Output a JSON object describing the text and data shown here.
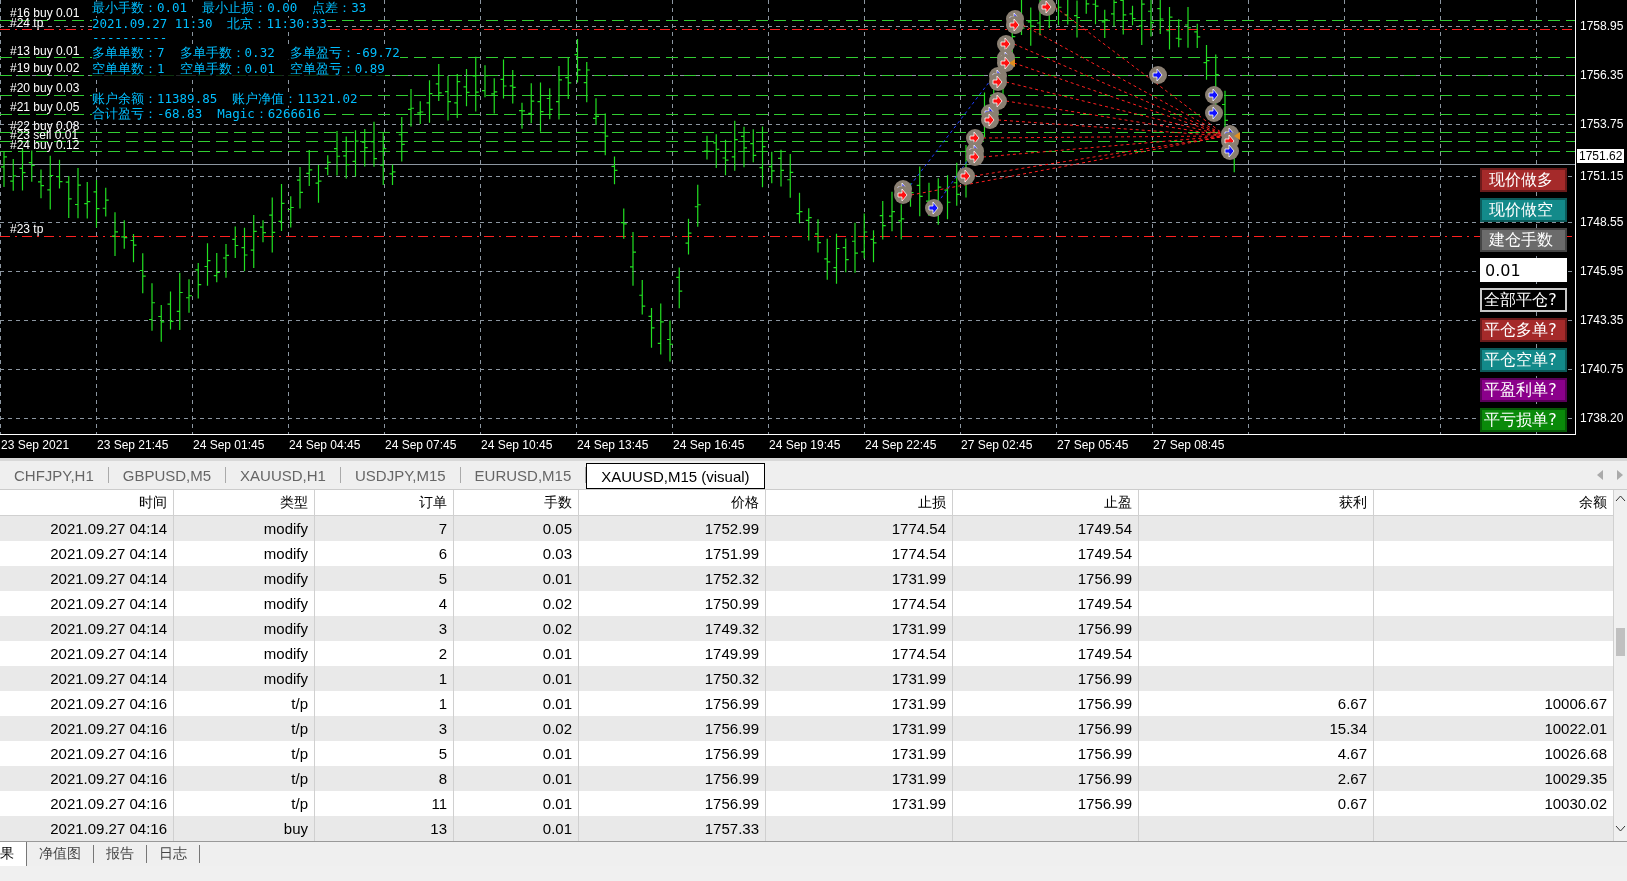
{
  "chart": {
    "info_lines": [
      "最小手数：0.01  最小止损：0.00  点差：33",
      "2021.09.27 11:30  北京：11:30:33",
      "----------",
      "多单单数：7  多单手数：0.32  多单盈亏：-69.72",
      "空单单数：1  空单手数：0.01  空单盈亏：0.89",
      "账户余额：11389.85  账户净值：11321.02",
      "合计盈亏：-68.83  Magic：6266616"
    ],
    "order_labels": [
      "#16 buy 0.01",
      "#24 tp",
      "#13 buy 0.01",
      "#19 buy 0.02",
      "#20 buy 0.03",
      "#21 buy 0.05",
      "#22 buy 0.08",
      "#23 sell 0.01",
      "#24 buy 0.12",
      "#23 tp"
    ],
    "price_labels": [
      "1758.95",
      "1756.35",
      "1753.75",
      "1751.15",
      "1748.55",
      "1745.95",
      "1743.35",
      "1740.75",
      "1738.20"
    ],
    "current_price": "1751.62",
    "time_labels": [
      "23 Sep 2021",
      "23 Sep 21:45",
      "24 Sep 01:45",
      "24 Sep 04:45",
      "24 Sep 07:45",
      "24 Sep 10:45",
      "24 Sep 13:45",
      "24 Sep 16:45",
      "24 Sep 19:45",
      "24 Sep 22:45",
      "27 Sep 02:45",
      "27 Sep 05:45",
      "27 Sep 08:45"
    ],
    "controls": [
      {
        "kind": "button",
        "label": "现价做多",
        "color": "#a52a2a"
      },
      {
        "kind": "button",
        "label": "现价做空",
        "color": "#138a8a"
      },
      {
        "kind": "button",
        "label": "建仓手数",
        "color": "#6b6b6b"
      },
      {
        "kind": "input",
        "value": "0.01"
      },
      {
        "kind": "outline",
        "label": "全部平仓?"
      },
      {
        "kind": "button",
        "label": "平仓多单?",
        "color": "#a52a2a"
      },
      {
        "kind": "button",
        "label": "平仓空单?",
        "color": "#138a8a"
      },
      {
        "kind": "button",
        "label": "平盈利单?",
        "color": "#8b008b"
      },
      {
        "kind": "button",
        "label": "平亏损单?",
        "color": "#0a8a0a"
      }
    ]
  },
  "symbol_tabs": [
    {
      "label": "CHFJPY,H1",
      "selected": false
    },
    {
      "label": "GBPUSD,M5",
      "selected": false
    },
    {
      "label": "XAUUSD,H1",
      "selected": false
    },
    {
      "label": "USDJPY,M15",
      "selected": false
    },
    {
      "label": "EURUSD,M15",
      "selected": false
    },
    {
      "label": "XAUUSD,M15 (visual)",
      "selected": true
    }
  ],
  "table": {
    "columns": [
      "时间",
      "类型",
      "订单",
      "手数",
      "价格",
      "止损",
      "止盈",
      "获利",
      "余额"
    ],
    "rows": [
      {
        "time": "2021.09.27 04:14",
        "type": "modify",
        "order": "7",
        "lots": "0.05",
        "price": "1752.99",
        "sl": "1774.54",
        "tp": "1749.54"
      },
      {
        "time": "2021.09.27 04:14",
        "type": "modify",
        "order": "6",
        "lots": "0.03",
        "price": "1751.99",
        "sl": "1774.54",
        "tp": "1749.54"
      },
      {
        "time": "2021.09.27 04:14",
        "type": "modify",
        "order": "5",
        "lots": "0.01",
        "price": "1752.32",
        "sl": "1731.99",
        "tp": "1756.99"
      },
      {
        "time": "2021.09.27 04:14",
        "type": "modify",
        "order": "4",
        "lots": "0.02",
        "price": "1750.99",
        "sl": "1774.54",
        "tp": "1749.54"
      },
      {
        "time": "2021.09.27 04:14",
        "type": "modify",
        "order": "3",
        "lots": "0.02",
        "price": "1749.32",
        "sl": "1731.99",
        "tp": "1756.99"
      },
      {
        "time": "2021.09.27 04:14",
        "type": "modify",
        "order": "2",
        "lots": "0.01",
        "price": "1749.99",
        "sl": "1774.54",
        "tp": "1749.54"
      },
      {
        "time": "2021.09.27 04:14",
        "type": "modify",
        "order": "1",
        "lots": "0.01",
        "price": "1750.32",
        "sl": "1731.99",
        "tp": "1756.99"
      },
      {
        "time": "2021.09.27 04:16",
        "type": "t/p",
        "order": "1",
        "lots": "0.01",
        "price": "1756.99",
        "sl": "1731.99",
        "tp": "1756.99",
        "profit": "6.67",
        "balance": "10006.67"
      },
      {
        "time": "2021.09.27 04:16",
        "type": "t/p",
        "order": "3",
        "lots": "0.02",
        "price": "1756.99",
        "sl": "1731.99",
        "tp": "1756.99",
        "profit": "15.34",
        "balance": "10022.01"
      },
      {
        "time": "2021.09.27 04:16",
        "type": "t/p",
        "order": "5",
        "lots": "0.01",
        "price": "1756.99",
        "sl": "1731.99",
        "tp": "1756.99",
        "profit": "4.67",
        "balance": "10026.68"
      },
      {
        "time": "2021.09.27 04:16",
        "type": "t/p",
        "order": "8",
        "lots": "0.01",
        "price": "1756.99",
        "sl": "1731.99",
        "tp": "1756.99",
        "profit": "2.67",
        "balance": "10029.35"
      },
      {
        "time": "2021.09.27 04:16",
        "type": "t/p",
        "order": "11",
        "lots": "0.01",
        "price": "1756.99",
        "sl": "1731.99",
        "tp": "1756.99",
        "profit": "0.67",
        "balance": "10030.02"
      },
      {
        "time": "2021.09.27 04:16",
        "type": "buy",
        "order": "13",
        "lots": "0.01",
        "price": "1757.33"
      }
    ]
  },
  "bottom_tabs": [
    {
      "label": "果",
      "selected": true
    },
    {
      "label": "净值图",
      "selected": false
    },
    {
      "label": "报告",
      "selected": false
    },
    {
      "label": "日志",
      "selected": false
    }
  ]
}
